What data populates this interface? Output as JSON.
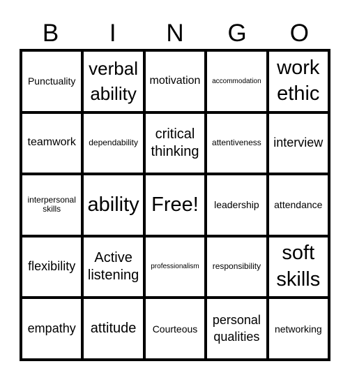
{
  "header": {
    "letters": [
      "B",
      "I",
      "N",
      "G",
      "O"
    ]
  },
  "cells": [
    {
      "text": "Punctuality",
      "size": "s-md"
    },
    {
      "text": "verbal ability",
      "size": "s-xxl"
    },
    {
      "text": "motivation",
      "size": "s-lg"
    },
    {
      "text": "accommodation",
      "size": "s-xs"
    },
    {
      "text": "work ethic",
      "size": "s-xxxl"
    },
    {
      "text": "teamwork",
      "size": "s-lg"
    },
    {
      "text": "dependability",
      "size": "s-sm"
    },
    {
      "text": "critical thinking",
      "size": "s-xl"
    },
    {
      "text": "attentiveness",
      "size": "s-sm"
    },
    {
      "text": "interview",
      "size": "s-ml"
    },
    {
      "text": "interpersonal skills",
      "size": "s-sm"
    },
    {
      "text": "ability",
      "size": "s-xxxl"
    },
    {
      "text": "Free!",
      "size": "s-xxxl"
    },
    {
      "text": "leadership",
      "size": "s-md"
    },
    {
      "text": "attendance",
      "size": "s-md"
    },
    {
      "text": "flexibility",
      "size": "s-ml"
    },
    {
      "text": "Active listening",
      "size": "s-xl"
    },
    {
      "text": "professionalism",
      "size": "s-xs"
    },
    {
      "text": "responsibility",
      "size": "s-sm"
    },
    {
      "text": "soft skills",
      "size": "s-xxxl"
    },
    {
      "text": "empathy",
      "size": "s-ml"
    },
    {
      "text": "attitude",
      "size": "s-xl"
    },
    {
      "text": "Courteous",
      "size": "s-md"
    },
    {
      "text": "personal qualities",
      "size": "s-ml"
    },
    {
      "text": "networking",
      "size": "s-md"
    }
  ]
}
